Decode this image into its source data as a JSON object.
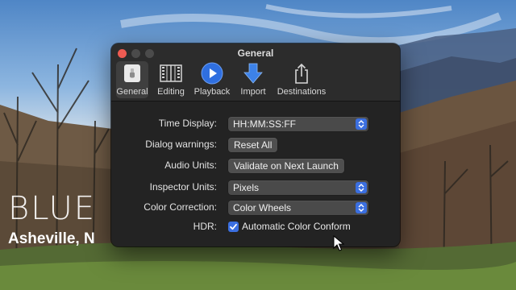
{
  "background": {
    "title_text": "BLUE R",
    "subtitle_text": "Asheville, N"
  },
  "window": {
    "title": "General",
    "toolbar": [
      {
        "label": "General",
        "icon": "general-switch-icon",
        "selected": true
      },
      {
        "label": "Editing",
        "icon": "film-strip-icon",
        "selected": false
      },
      {
        "label": "Playback",
        "icon": "play-circle-icon",
        "selected": false
      },
      {
        "label": "Import",
        "icon": "download-arrow-icon",
        "selected": false
      },
      {
        "label": "Destinations",
        "icon": "share-icon",
        "selected": false
      }
    ],
    "settings": {
      "time_display": {
        "label": "Time Display:",
        "value": "HH:MM:SS:FF"
      },
      "dialog_warnings": {
        "label": "Dialog warnings:",
        "button": "Reset All"
      },
      "audio_units": {
        "label": "Audio Units:",
        "button": "Validate on Next Launch"
      },
      "inspector_units": {
        "label": "Inspector Units:",
        "value": "Pixels"
      },
      "color_correction": {
        "label": "Color Correction:",
        "value": "Color Wheels"
      },
      "hdr": {
        "label": "HDR:",
        "checkbox_label": "Automatic Color Conform",
        "checked": true
      }
    }
  },
  "colors": {
    "accent": "#3b6fe0",
    "window_bg": "#232323",
    "close": "#ee5b52"
  }
}
